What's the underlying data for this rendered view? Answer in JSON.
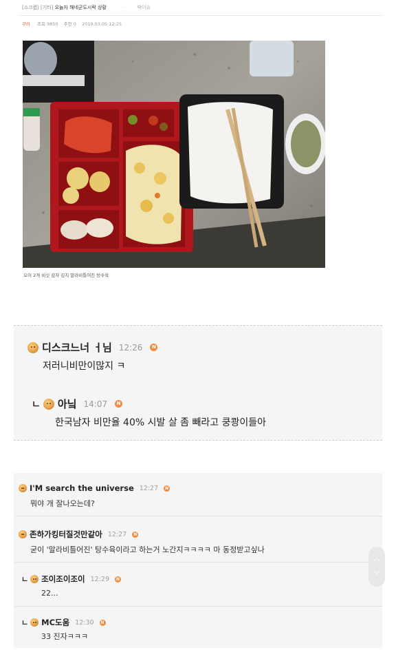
{
  "header": {
    "category_scrap": "[스크랩]",
    "category_etc": "[기타]",
    "post_title": "오늘자 해네군도시락 상황",
    "author": "박이슈"
  },
  "meta": {
    "nickname": "쿠라",
    "views": "조회 9850",
    "recommend": "추천 0",
    "date": "2019.03.05 12:25"
  },
  "photo": {
    "caption": "오이 2개 비싯 감자 김치 말라비틀어진 탕수육"
  },
  "comments_top": [
    {
      "name": "디스크느너 ㅓ님",
      "time": "12:26",
      "badge": "N",
      "text": "저러니비만이많지 ㅋ"
    },
    {
      "reply_mark": "ㄴ",
      "name": "아닠",
      "time": "14:07",
      "badge": "N",
      "text": "한국남자 비만율 40% 시발 살 좀 빼라고 쿵쾅이들아"
    }
  ],
  "comments_bottom": [
    {
      "name": "I'M search the universe",
      "time": "12:27",
      "badge": "N",
      "text": "뭐야 개 잘나오는데?"
    },
    {
      "name": "존하가킹터질것만같아",
      "time": "12:27",
      "badge": "N",
      "text": "굳이 '말라비틀어진' 탕수육이라고 하는거 노간지ㅋㅋㅋㅋ 마 동정받고싶나"
    },
    {
      "reply_mark": "ㄴ",
      "name": "조이조이조이",
      "time": "12:29",
      "badge": "N",
      "text": "22..."
    },
    {
      "reply_mark": "ㄴ",
      "name": "MC도움",
      "time": "12:30",
      "badge": "N",
      "text": "33 진자ㅋㅋㅋ"
    }
  ],
  "scroller": {
    "up": "︿",
    "down": "﹀"
  },
  "colors": {
    "accent": "#f08a3e",
    "box_bg": "#f5f5f5",
    "meta": "#999999"
  }
}
